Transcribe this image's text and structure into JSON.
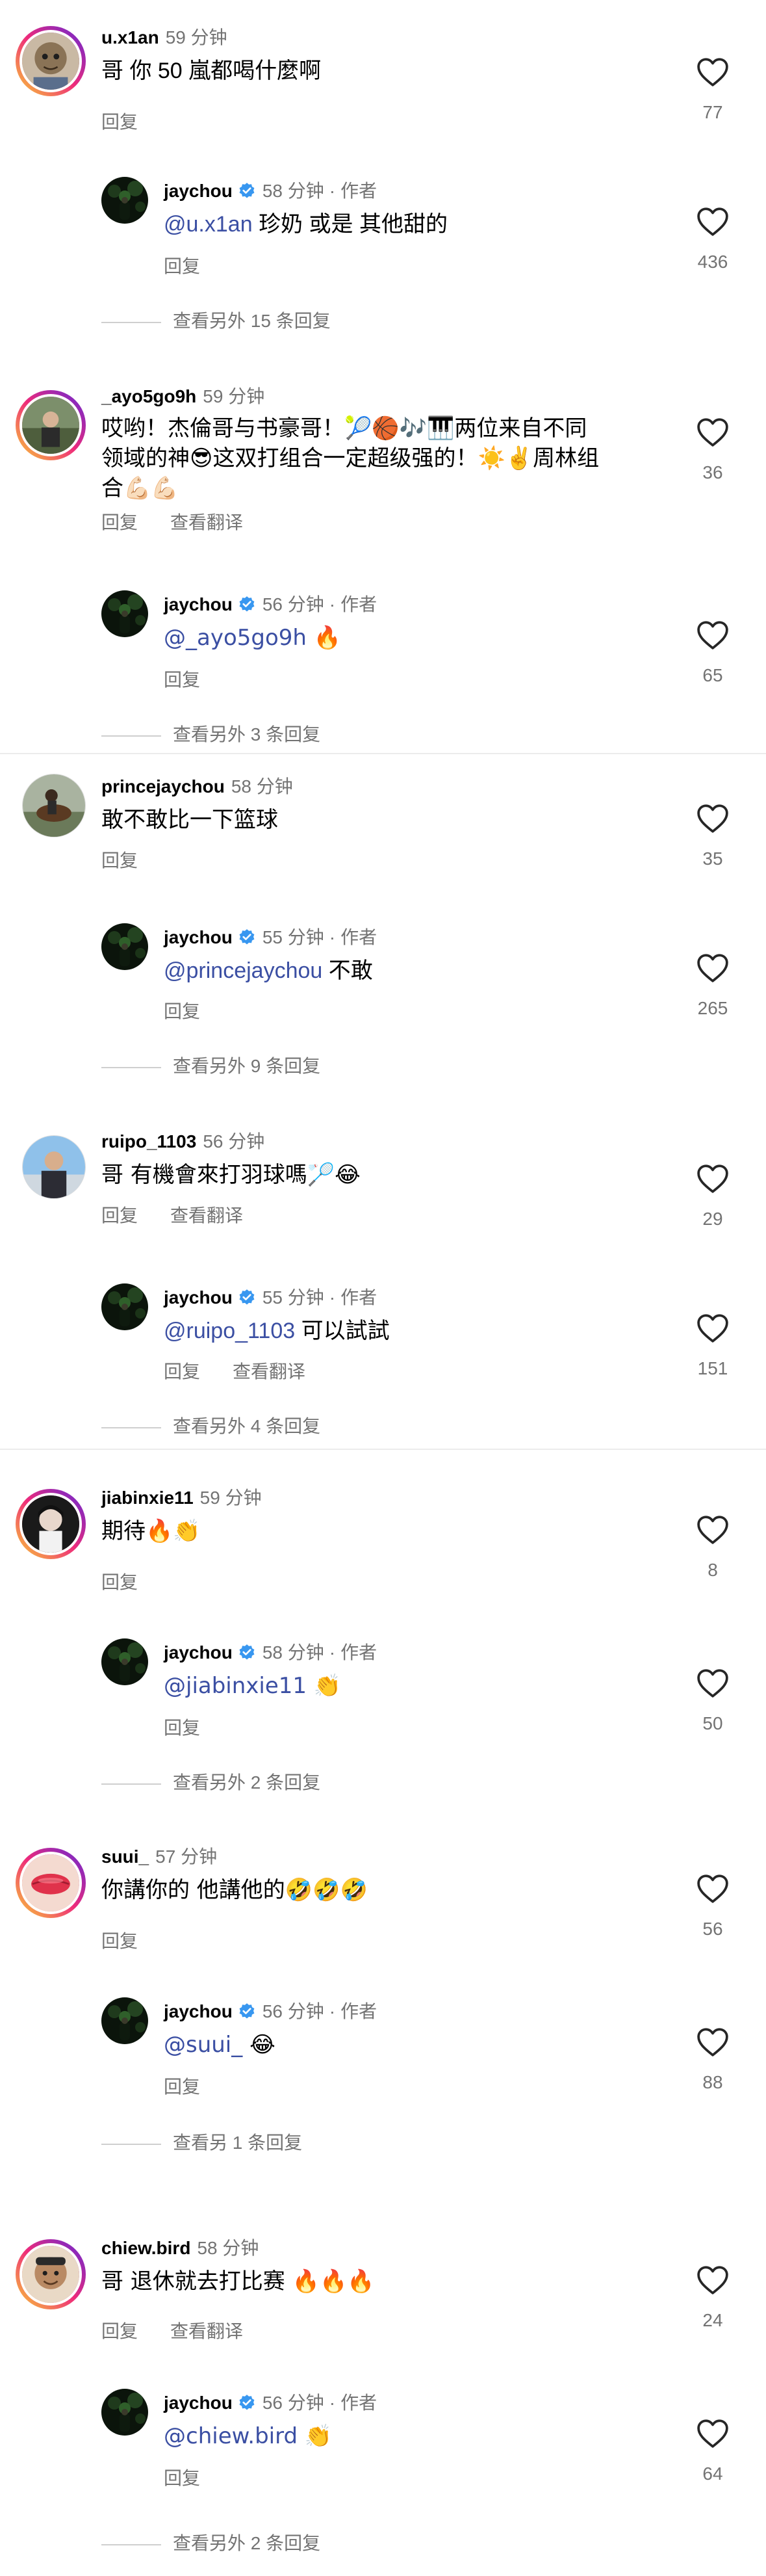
{
  "labels": {
    "reply": "回复",
    "author": "作者",
    "translate": "查看翻译",
    "dot": "·"
  },
  "colors": {
    "mention": "#3b4fa3",
    "verified": "#3897f0",
    "meta_grey": "#737373"
  },
  "threads": [
    {
      "comment": {
        "user": "u.x1an",
        "time": "59 分钟",
        "text": "哥 你 50 嵐都喝什麼啊",
        "likes": "77"
      },
      "reply": {
        "user": "jaychou",
        "time": "58 分钟",
        "mention": "@u.x1an",
        "text": "珍奶 或是 其他甜的",
        "likes": "436"
      },
      "more": "查看另外 15 条回复"
    },
    {
      "comment": {
        "user": "_ayo5go9h",
        "time": "59 分钟",
        "text_line1": "哎哟！杰倫哥与书豪哥！🎾🏀🎶🎹两位来自不同",
        "text_line2": "领域的神😎这双打组合一定超级强的！☀️✌️周林组",
        "text_line3": "合💪🏻💪🏻",
        "likes": "36"
      },
      "reply": {
        "user": "jaychou",
        "time": "56 分钟",
        "mention": "@_ayo5go9h",
        "text": "🔥",
        "likes": "65"
      },
      "more": "查看另外 3 条回复"
    },
    {
      "comment": {
        "user": "princejaychou",
        "time": "58 分钟",
        "text": "敢不敢比一下篮球",
        "likes": "35"
      },
      "reply": {
        "user": "jaychou",
        "time": "55 分钟",
        "mention": "@princejaychou",
        "text": "不敢",
        "likes": "265"
      },
      "more": "查看另外 9 条回复"
    },
    {
      "comment": {
        "user": "ruipo_1103",
        "time": "56 分钟",
        "text": "哥 有機會來打羽球嗎🏸😂",
        "likes": "29"
      },
      "reply": {
        "user": "jaychou",
        "time": "55 分钟",
        "mention": "@ruipo_1103",
        "text": "可以試試",
        "likes": "151"
      },
      "more": "查看另外 4 条回复"
    },
    {
      "comment": {
        "user": "jiabinxie11",
        "time": "59 分钟",
        "text": "期待🔥👏",
        "likes": "8"
      },
      "reply": {
        "user": "jaychou",
        "time": "58 分钟",
        "mention": "@jiabinxie11",
        "text": "👏",
        "likes": "50"
      },
      "more": "查看另外 2 条回复"
    },
    {
      "comment": {
        "user": "suui_",
        "time": "57 分钟",
        "text": "你講你的 他講他的🤣🤣🤣",
        "likes": "56"
      },
      "reply": {
        "user": "jaychou",
        "time": "56 分钟",
        "mention": "@suui_",
        "text": "😂",
        "likes": "88"
      },
      "more": "查看另 1 条回复"
    },
    {
      "comment": {
        "user": "chiew.bird",
        "time": "58 分钟",
        "text": "哥 退休就去打比赛 🔥🔥🔥",
        "likes": "24"
      },
      "reply": {
        "user": "jaychou",
        "time": "56 分钟",
        "mention": "@chiew.bird",
        "text": "👏",
        "likes": "64"
      },
      "more": "查看另外 2 条回复"
    }
  ]
}
